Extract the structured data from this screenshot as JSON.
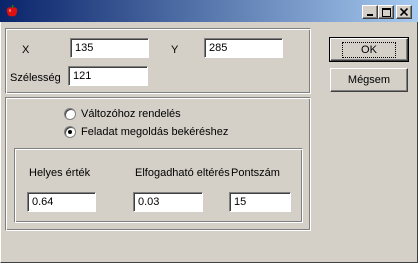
{
  "window": {
    "icon": "apple-icon",
    "controls": {
      "minimize": "minimize-icon",
      "maximize": "maximize-icon",
      "close": "close-icon"
    }
  },
  "position": {
    "x_label": "X",
    "x_value": "135",
    "y_label": "Y",
    "y_value": "285",
    "width_label": "Szélesség",
    "width_value": "121"
  },
  "buttons": {
    "ok": "OK",
    "cancel": "Mégsem"
  },
  "mode": {
    "options": [
      {
        "label": "Változóhoz rendelés",
        "selected": false
      },
      {
        "label": "Feladat megoldás bekéréshez",
        "selected": true
      }
    ]
  },
  "task": {
    "correct_label": "Helyes érték",
    "correct_value": "0.64",
    "tolerance_label": "Elfogadható eltérés",
    "tolerance_value": "0.03",
    "points_label": "Pontszám",
    "points_value": "15"
  }
}
